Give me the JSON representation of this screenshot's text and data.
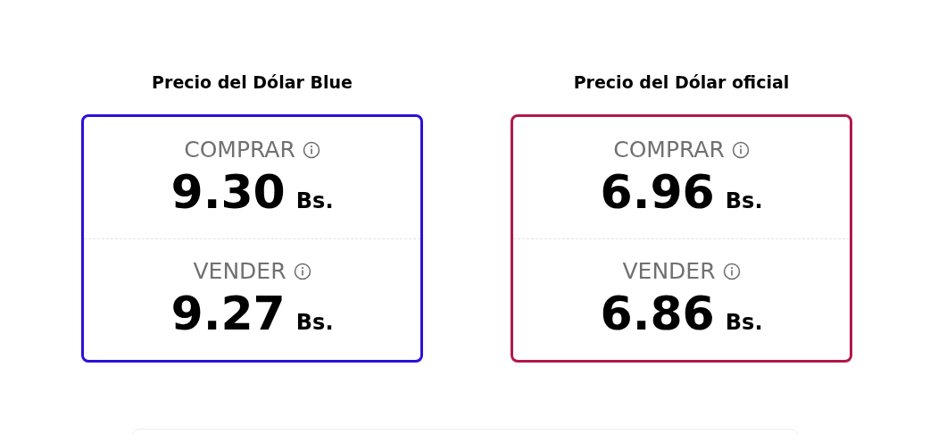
{
  "cards": [
    {
      "title": "Precio del Dólar Blue",
      "color": "#2c10d9",
      "rows": [
        {
          "label": "COMPRAR",
          "value": "9.30",
          "unit": "Bs."
        },
        {
          "label": "VENDER",
          "value": "9.27",
          "unit": "Bs."
        }
      ]
    },
    {
      "title": "Precio del Dólar oficial",
      "color": "#b3184b",
      "rows": [
        {
          "label": "COMPRAR",
          "value": "6.96",
          "unit": "Bs."
        },
        {
          "label": "VENDER",
          "value": "6.86",
          "unit": "Bs."
        }
      ]
    }
  ]
}
